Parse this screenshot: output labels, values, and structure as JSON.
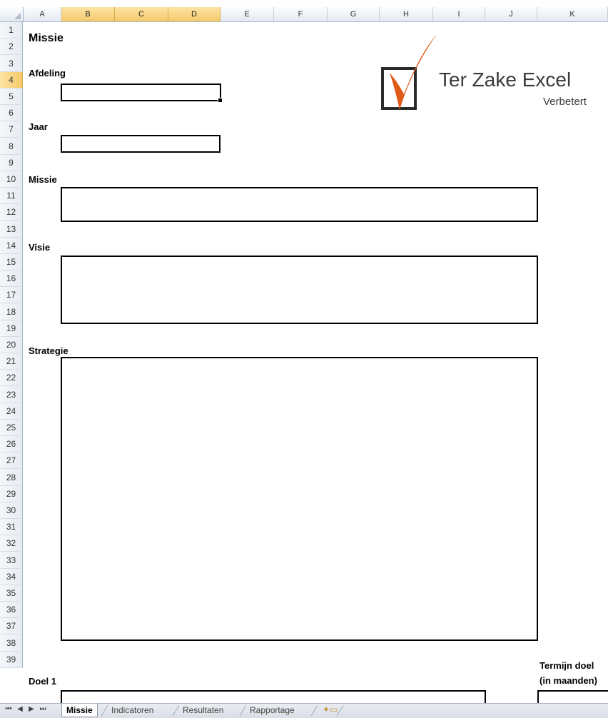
{
  "columns": [
    "A",
    "B",
    "C",
    "D",
    "E",
    "F",
    "G",
    "H",
    "I",
    "J",
    "K"
  ],
  "rows": [
    "1",
    "2",
    "3",
    "4",
    "5",
    "6",
    "7",
    "8",
    "9",
    "10",
    "11",
    "12",
    "13",
    "14",
    "15",
    "16",
    "17",
    "18",
    "19",
    "20",
    "21",
    "22",
    "23",
    "24",
    "25",
    "26",
    "27",
    "28",
    "29",
    "30",
    "31",
    "32",
    "33",
    "34",
    "35",
    "36",
    "37",
    "38",
    "39"
  ],
  "sheet": {
    "title": "Missie",
    "labels": {
      "afdeling": "Afdeling",
      "jaar": "Jaar",
      "missie": "Missie",
      "visie": "Visie",
      "strategie": "Strategie",
      "doel1": "Doel 1",
      "termijn_line1": "Termijn doel",
      "termijn_line2": "(in maanden)"
    }
  },
  "logo": {
    "name": "Ter Zake Excel",
    "tagline": "Verbetert",
    "accent_color": "#e05a1a"
  },
  "tabs": {
    "items": [
      "Missie",
      "Indicatoren",
      "Resultaten",
      "Rapportage"
    ],
    "active": "Missie",
    "new_sheet_icon": "insert-sheet-icon"
  },
  "colors": {
    "header_selected": "#f5c96a",
    "grid_border": "#9eb6ce"
  }
}
